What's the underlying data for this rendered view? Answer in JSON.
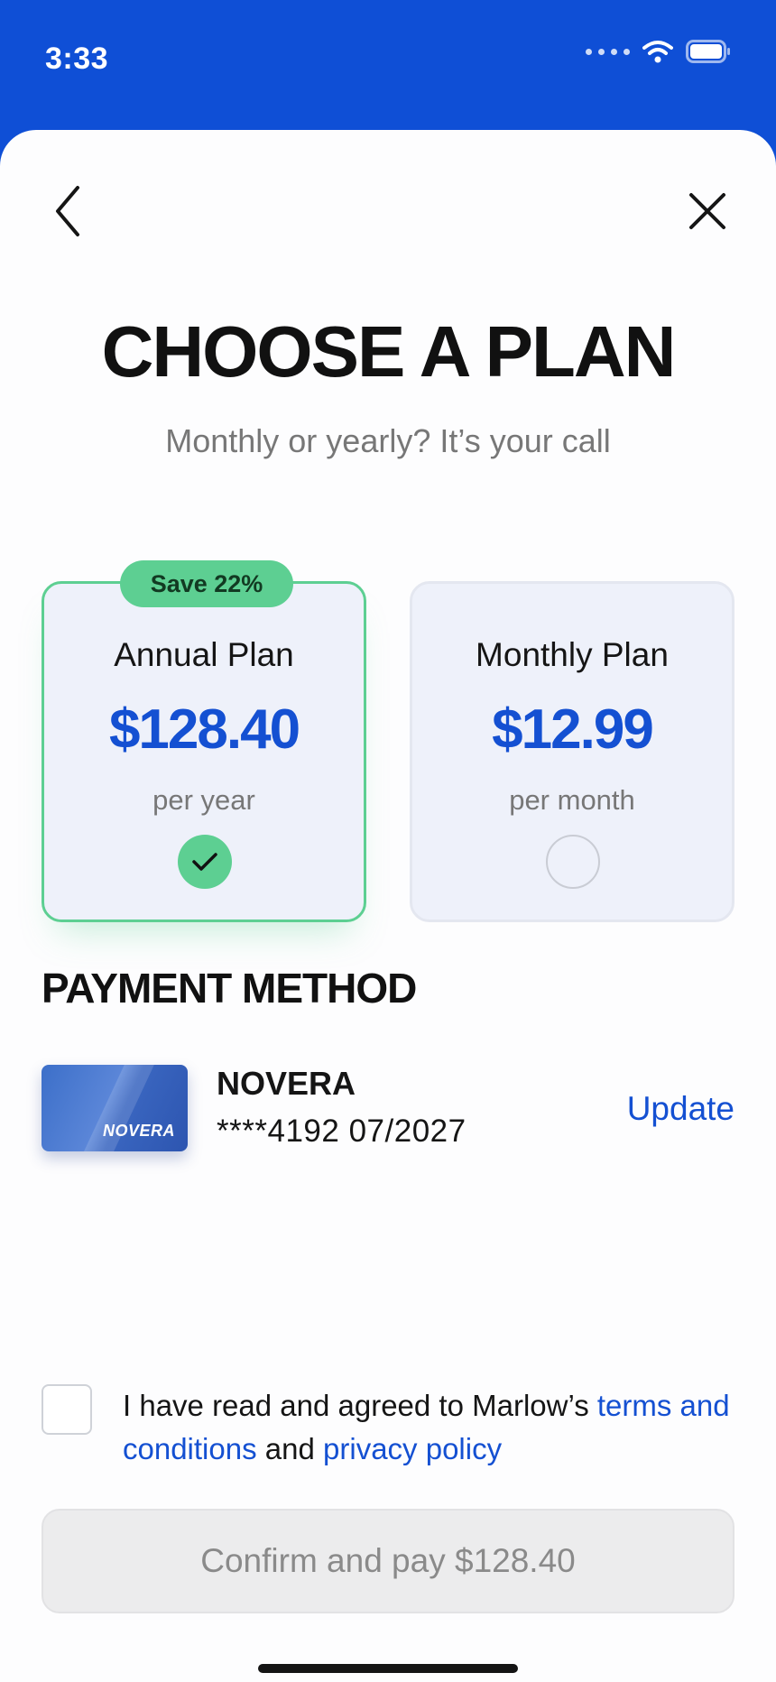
{
  "status_bar": {
    "time": "3:33",
    "icons": [
      "signal-dots-icon",
      "wifi-icon",
      "battery-icon"
    ]
  },
  "nav": {
    "back_icon": "chevron-left-icon",
    "close_icon": "close-icon"
  },
  "header": {
    "title": "CHOOSE A PLAN",
    "subtitle": "Monthly or yearly? It’s your call"
  },
  "plans": [
    {
      "badge": "Save 22%",
      "name": "Annual Plan",
      "price": "$128.40",
      "period": "per year",
      "selected": true
    },
    {
      "name": "Monthly Plan",
      "price": "$12.99",
      "period": "per month",
      "selected": false
    }
  ],
  "payment": {
    "heading": "PAYMENT METHOD",
    "card_logo_text": "NOVERA",
    "card_brand": "NOVERA",
    "card_details": "****4192 07/2027",
    "update_label": "Update"
  },
  "terms": {
    "checked": false,
    "prefix": "I have read and agreed to Marlow’s ",
    "terms_link": "terms and conditions",
    "middle": " and ",
    "privacy_link": "privacy policy"
  },
  "confirm": {
    "label": "Confirm and pay $128.40",
    "enabled": false
  },
  "colors": {
    "brand_blue": "#1450d2",
    "accent_green": "#5dcf92",
    "card_bg": "#eef1fa"
  }
}
